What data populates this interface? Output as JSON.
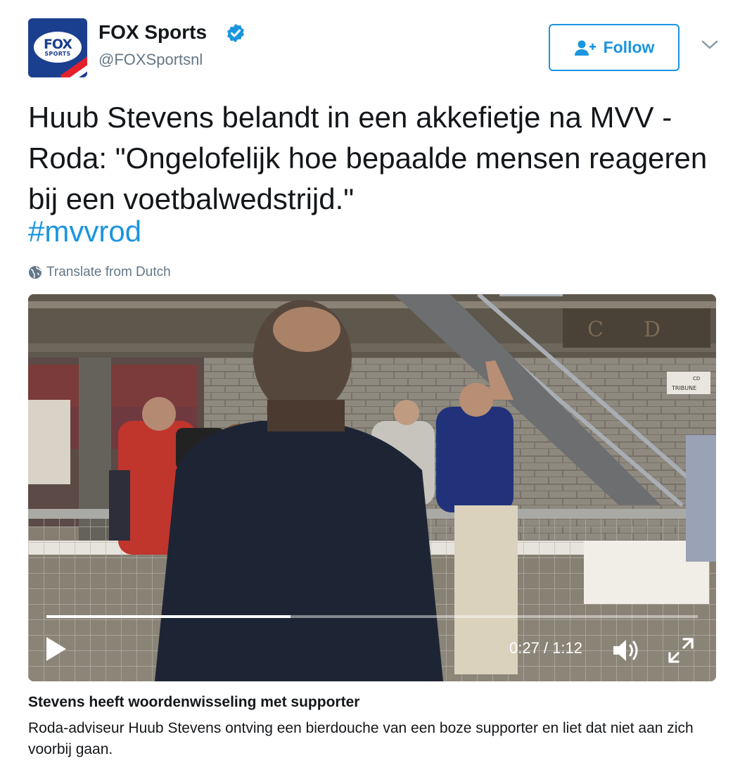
{
  "author": {
    "name": "FOX Sports",
    "handle": "@FOXSportsnl",
    "avatar_text": "FOX",
    "avatar_subtext": "SPORTS",
    "verified": true
  },
  "follow_button": {
    "label": "Follow",
    "icon": "add-user-icon"
  },
  "menu_icon": "chevron-down-icon",
  "tweet": {
    "text": "Huub Stevens belandt in een akkefietje na MVV - Roda: \"Ongelofelijk hoe bepaalde mensen reageren bij een voetbalwedstrijd.\"",
    "hashtag": "#mvvrod",
    "translate_label": "Translate from Dutch"
  },
  "video": {
    "current_time": "0:27",
    "duration": "1:12",
    "time_display": "0:27 / 1:12",
    "progress_fraction": 0.375,
    "signs": {
      "stand_left": "C",
      "stand_right": "D",
      "tribune": "TRIBUNE",
      "tribune_small": "CD"
    }
  },
  "card": {
    "title": "Stevens heeft woordenwisseling met supporter",
    "description": "Roda-adviseur Huub Stevens ontving een bierdouche van een boze supporter en liet dat niet aan zich voorbij gaan."
  },
  "colors": {
    "accent": "#1b95e0",
    "text": "#14171a",
    "muted": "#657786",
    "brand_blue": "#1b3f8f"
  }
}
